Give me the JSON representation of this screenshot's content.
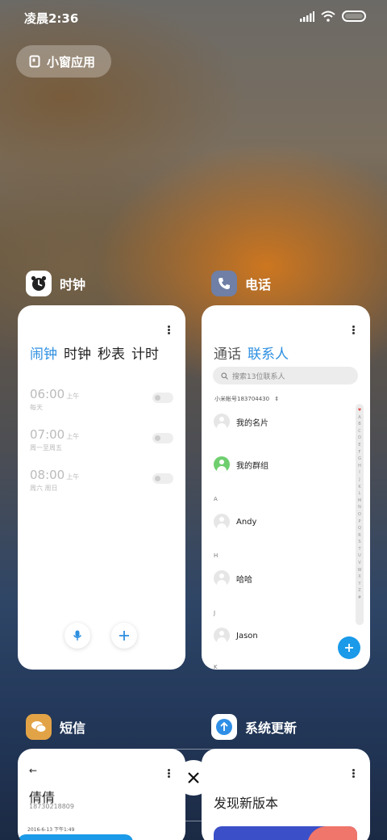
{
  "status_bar": {
    "time": "凌晨2:36"
  },
  "float_window_button": {
    "label": "小窗应用"
  },
  "clock": {
    "app_name": "时钟",
    "tabs": [
      "闹钟",
      "时钟",
      "秒表",
      "计时"
    ],
    "alarms": [
      {
        "time": "06:00",
        "ampm": "上午",
        "repeat": "每天"
      },
      {
        "time": "07:00",
        "ampm": "上午",
        "repeat": "周一至周五"
      },
      {
        "time": "08:00",
        "ampm": "上午",
        "repeat": "周六 周日"
      }
    ]
  },
  "phone": {
    "app_name": "电话",
    "tabs": [
      "通话",
      "联系人"
    ],
    "search_placeholder": "搜索13位联系人",
    "account": "小米帐号183704430",
    "my_card": "我的名片",
    "my_groups": "我的群组",
    "sections": [
      {
        "letter": "A",
        "name": "Andy"
      },
      {
        "letter": "H",
        "name": "哈哈"
      },
      {
        "letter": "J",
        "name": "Jason"
      }
    ],
    "bottom_letter": "K",
    "index_letters": [
      "♥",
      "A",
      "B",
      "C",
      "D",
      "E",
      "F",
      "G",
      "H",
      "I",
      "J",
      "K",
      "L",
      "M",
      "N",
      "O",
      "P",
      "Q",
      "R",
      "S",
      "T",
      "U",
      "V",
      "W",
      "X",
      "Y",
      "Z",
      "#"
    ]
  },
  "sms": {
    "app_name": "短信",
    "contact_name": "倩倩",
    "contact_number": "18730218809",
    "timestamp": "2016-6-13 下午1:49"
  },
  "update": {
    "app_name": "系统更新",
    "headline": "发现新版本"
  },
  "colors": {
    "accent": "#2d8fe0",
    "fab": "#1a9ae8",
    "clock_icon_bg": "#ffffff",
    "phone_icon_bg": "#6f7fa5",
    "sms_icon_bg": "#e2a347",
    "update_icon_bg": "#2f8fe6"
  }
}
